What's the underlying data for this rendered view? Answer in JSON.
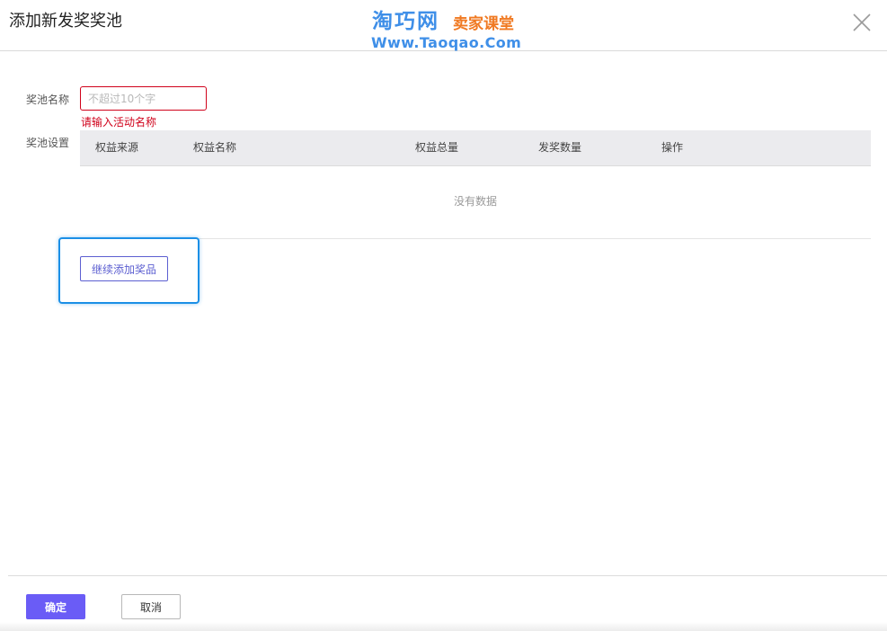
{
  "dialog": {
    "title": "添加新发奖奖池"
  },
  "watermark": {
    "logo": "淘巧网",
    "slogan": "卖家课堂",
    "url": "Www.Taoqao.Com"
  },
  "icons": {
    "close": "close-icon"
  },
  "form": {
    "pool_name_label": "奖池名称",
    "pool_name_placeholder": "不超过10个字",
    "pool_name_value": "",
    "pool_name_error": "请输入活动名称",
    "pool_settings_label": "奖池设置"
  },
  "table": {
    "columns": [
      "权益来源",
      "权益名称",
      "权益总量",
      "发奖数量",
      "操作"
    ],
    "rows": [],
    "empty_text": "没有数据"
  },
  "actions": {
    "add_prize_label": "继续添加奖品"
  },
  "footer": {
    "confirm_label": "确定",
    "cancel_label": "取消"
  },
  "colors": {
    "primary": "#6a5cf6",
    "error": "#d0021b",
    "highlight": "#1b8fe6",
    "table_header_bg": "#ebebee",
    "watermark_blue": "#3f8fe8",
    "watermark_orange": "#f07a23"
  }
}
